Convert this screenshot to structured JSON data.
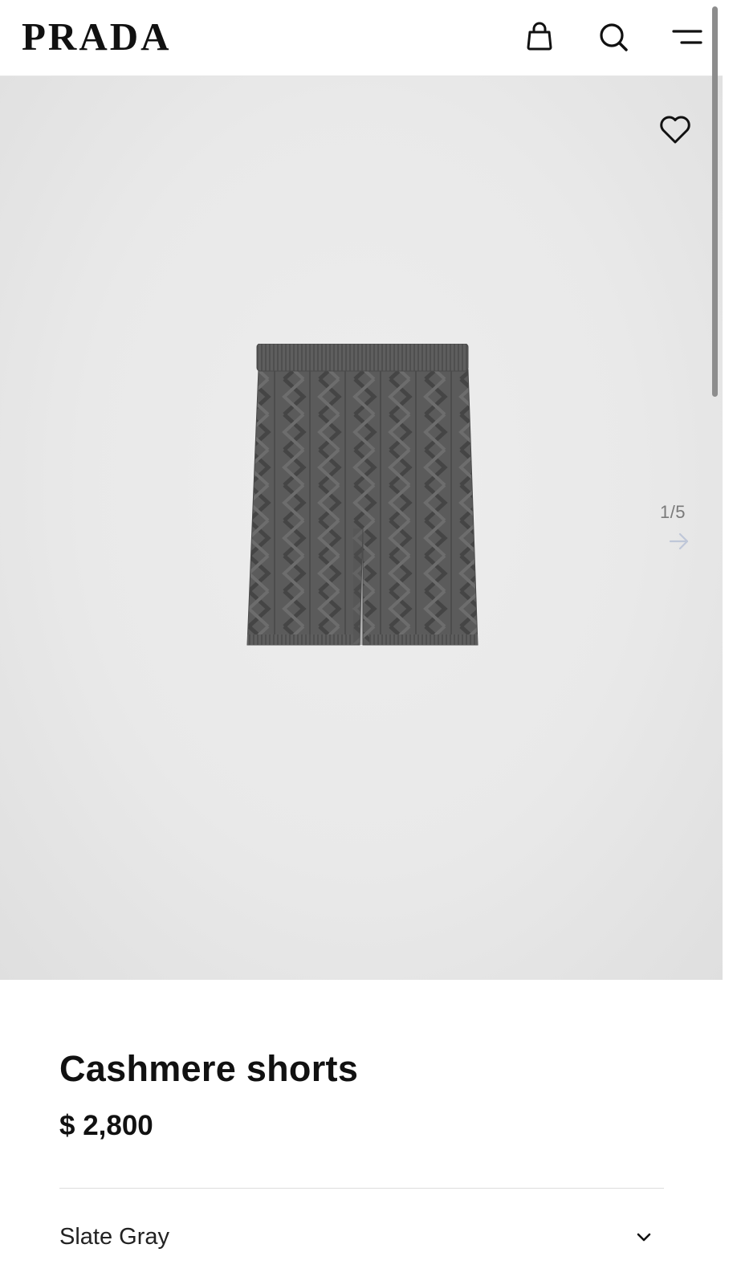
{
  "header": {
    "logo_text": "PRADA",
    "icons": {
      "bag": "shopping-bag-icon",
      "search": "search-icon",
      "menu": "menu-icon"
    }
  },
  "gallery": {
    "image_alt": "Cashmere shorts",
    "pager": "1/5",
    "icons": {
      "wishlist": "heart-icon",
      "next": "arrow-right-icon"
    }
  },
  "product": {
    "title": "Cashmere shorts",
    "price": "$ 2,800",
    "color_selected": "Slate Gray"
  },
  "colors": {
    "text": "#111111",
    "product_gray": "#5a5a5a",
    "gallery_bg": "#e9e9e9",
    "pager_text": "#7a7a7a"
  }
}
